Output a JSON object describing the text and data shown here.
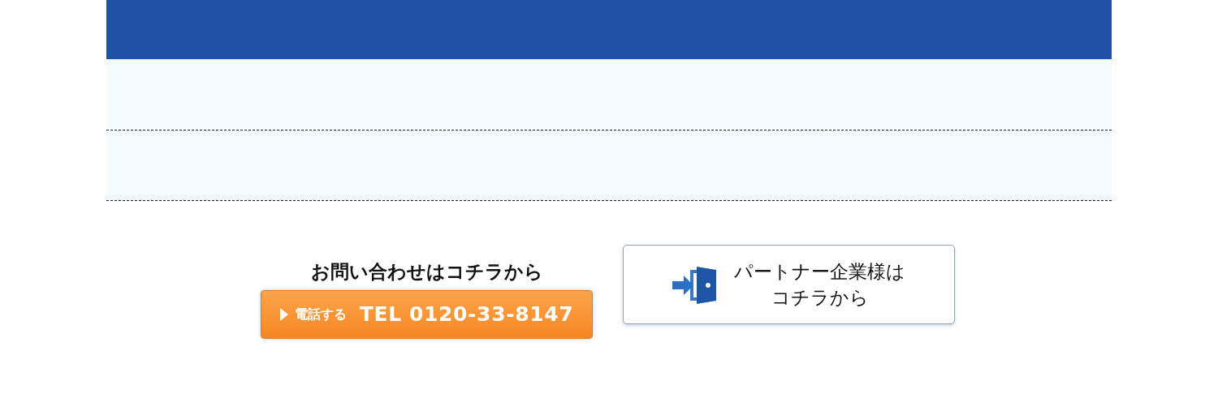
{
  "contact": {
    "heading": "お問い合わせはコチラから",
    "phone_button": {
      "label": "電話する",
      "number": "TEL 0120-33-8147"
    }
  },
  "partner_button": {
    "lines": [
      "パートナー企業様は",
      "コチラから"
    ]
  }
}
